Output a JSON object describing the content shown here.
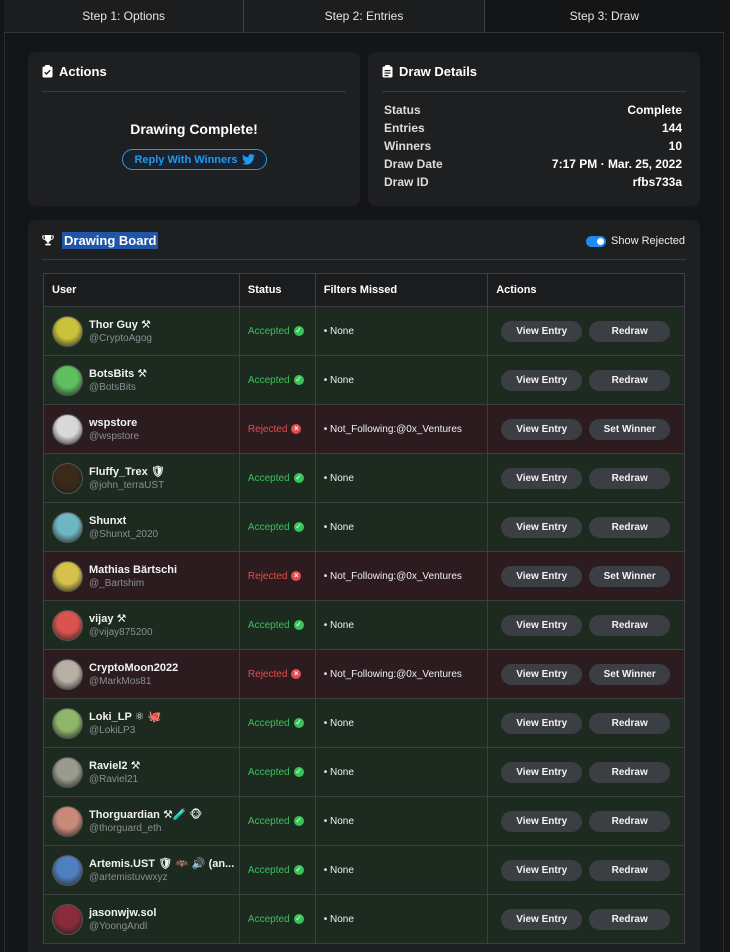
{
  "steps": [
    "Step 1: Options",
    "Step 2: Entries",
    "Step 3: Draw"
  ],
  "actions": {
    "title": "Actions",
    "status_heading": "Drawing Complete!",
    "reply_button": "Reply With Winners"
  },
  "details": {
    "title": "Draw Details",
    "rows": [
      {
        "label": "Status",
        "value": "Complete"
      },
      {
        "label": "Entries",
        "value": "144"
      },
      {
        "label": "Winners",
        "value": "10"
      },
      {
        "label": "Draw Date",
        "value": "7:17 PM · Mar. 25, 2022"
      },
      {
        "label": "Draw ID",
        "value": "rfbs733a"
      }
    ]
  },
  "board": {
    "title": "Drawing Board",
    "toggle_label": "Show Rejected",
    "toggle_on": true,
    "columns": [
      "User",
      "Status",
      "Filters Missed",
      "Actions"
    ],
    "rows": [
      {
        "name": "Thor Guy ⚒",
        "handle": "@CryptoAgog",
        "status": "Accepted",
        "filter": "• None",
        "btn1": "View Entry",
        "btn2": "Redraw",
        "state": "accepted",
        "avatar_color": "#c9c23a"
      },
      {
        "name": "BotsBits ⚒",
        "handle": "@BotsBits",
        "status": "Accepted",
        "filter": "• None",
        "btn1": "View Entry",
        "btn2": "Redraw",
        "state": "accepted",
        "avatar_color": "#5fbf5f"
      },
      {
        "name": "wspstore",
        "handle": "@wspstore",
        "status": "Rejected",
        "filter": "• Not_Following:@0x_Ventures",
        "btn1": "View Entry",
        "btn2": "Set Winner",
        "state": "rejected",
        "avatar_color": "#d8d8d8"
      },
      {
        "name": "Fluffy_Trex 🛡",
        "handle": "@john_terraUST",
        "status": "Accepted",
        "filter": "• None",
        "btn1": "View Entry",
        "btn2": "Redraw",
        "state": "accepted",
        "avatar_color": "#3a2a1a"
      },
      {
        "name": "Shunxt",
        "handle": "@Shunxt_2020",
        "status": "Accepted",
        "filter": "• None",
        "btn1": "View Entry",
        "btn2": "Redraw",
        "state": "accepted",
        "avatar_color": "#6fb6c4"
      },
      {
        "name": "Mathias Bärtschi",
        "handle": "@_Bartshim",
        "status": "Rejected",
        "filter": "• Not_Following:@0x_Ventures",
        "btn1": "View Entry",
        "btn2": "Set Winner",
        "state": "rejected",
        "avatar_color": "#d6c24a"
      },
      {
        "name": "vijay ⚒",
        "handle": "@vijay875200",
        "status": "Accepted",
        "filter": "• None",
        "btn1": "View Entry",
        "btn2": "Redraw",
        "state": "accepted",
        "avatar_color": "#d9534f"
      },
      {
        "name": "CryptoMoon2022",
        "handle": "@MarkMos81",
        "status": "Rejected",
        "filter": "• Not_Following:@0x_Ventures",
        "btn1": "View Entry",
        "btn2": "Set Winner",
        "state": "rejected",
        "avatar_color": "#b8b0a4"
      },
      {
        "name": "Loki_LP ⚛ 🐙",
        "handle": "@LokiLP3",
        "status": "Accepted",
        "filter": "• None",
        "btn1": "View Entry",
        "btn2": "Redraw",
        "state": "accepted",
        "avatar_color": "#8fb56a"
      },
      {
        "name": "Raviel2 ⚒",
        "handle": "@Raviel21",
        "status": "Accepted",
        "filter": "• None",
        "btn1": "View Entry",
        "btn2": "Redraw",
        "state": "accepted",
        "avatar_color": "#9a9a8e"
      },
      {
        "name": "Thorguardian ⚒🧪 🐵",
        "handle": "@thorguard_eth",
        "status": "Accepted",
        "filter": "• None",
        "btn1": "View Entry",
        "btn2": "Redraw",
        "state": "accepted",
        "avatar_color": "#c98a7a"
      },
      {
        "name": "Artemis.UST 🛡 🦇 🔊 (an...",
        "handle": "@artemistuvwxyz",
        "status": "Accepted",
        "filter": "• None",
        "btn1": "View Entry",
        "btn2": "Redraw",
        "state": "accepted",
        "avatar_color": "#4f7fbf"
      },
      {
        "name": "jasonwjw.sol",
        "handle": "@YoongAndl",
        "status": "Accepted",
        "filter": "• None",
        "btn1": "View Entry",
        "btn2": "Redraw",
        "state": "accepted",
        "avatar_color": "#8a2b3b"
      }
    ]
  }
}
